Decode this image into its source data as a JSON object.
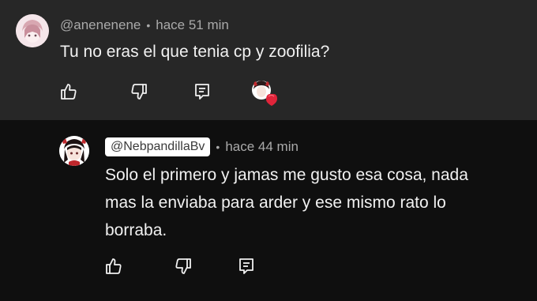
{
  "comment": {
    "handle": "@anenenene",
    "separator": "•",
    "time": "hace 51 min",
    "text": "Tu no eras el que tenia cp y zoofilia?",
    "actions": [
      "thumbs-up-icon",
      "thumbs-down-icon",
      "reply-icon",
      "creator-heart-icon"
    ]
  },
  "reply": {
    "handle": "@NebpandillaBv",
    "separator": "•",
    "time": "hace 44 min",
    "text": "Solo el primero y jamas me gusto esa cosa, nada mas la enviaba para arder y ese mismo rato lo borraba.",
    "actions": [
      "thumbs-up-icon",
      "thumbs-down-icon",
      "reply-icon"
    ]
  },
  "colors": {
    "top_bg": "#272727",
    "reply_bg": "#0f0f0f",
    "text": "#f1f1f1",
    "meta": "#aaaaaa",
    "heart": "#e0243a"
  }
}
